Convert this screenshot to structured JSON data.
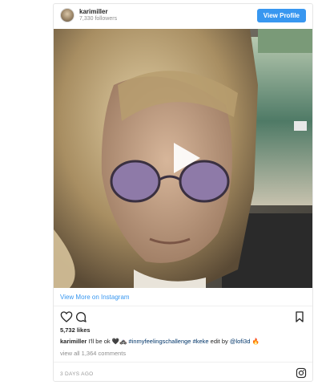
{
  "header": {
    "username": "karimiller",
    "followers": "7,330 followers",
    "view_profile_label": "View Profile"
  },
  "media": {
    "type": "video",
    "play_icon": "play-icon"
  },
  "view_more_label": "View More on Instagram",
  "actions": {
    "icons": [
      "heart-icon",
      "comment-icon",
      "bookmark-icon"
    ]
  },
  "likes": "5,732 likes",
  "caption": {
    "username": "karimiller",
    "text_start": "I'll be ok ",
    "emoji": "🖤🚓",
    "hashtags": "#inmyfeelingschallenge #keke",
    "text_mid": " edit by ",
    "mention": "@lofi3d",
    "text_end": " 🔥"
  },
  "comments_link": "view all 1,364 comments",
  "timestamp": "3 DAYS AGO",
  "footer_icon": "instagram-icon",
  "colors": {
    "accent": "#3897f0",
    "text": "#262626",
    "muted": "#8e8e8e",
    "tag": "#003569"
  }
}
